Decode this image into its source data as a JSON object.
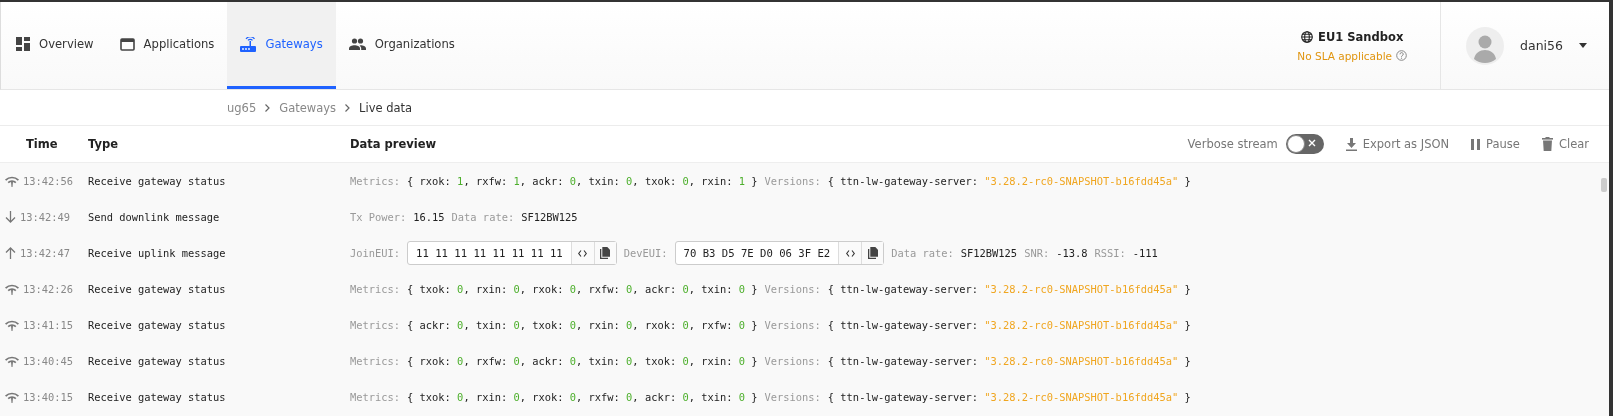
{
  "nav": {
    "tabs": [
      {
        "label": "Overview",
        "selected": false
      },
      {
        "label": "Applications",
        "selected": false
      },
      {
        "label": "Gateways",
        "selected": true
      },
      {
        "label": "Organizations",
        "selected": false
      }
    ]
  },
  "cluster": {
    "name": "**EU1** Sandbox",
    "note": "No SLA applicable"
  },
  "user": {
    "name": "dani56"
  },
  "breadcrumbs": [
    {
      "label": "ug65",
      "current": false
    },
    {
      "label": "Gateways",
      "current": false
    },
    {
      "label": "Live data",
      "current": true
    }
  ],
  "table": {
    "columns": [
      "Time",
      "Type",
      "Data preview"
    ],
    "toolbar": {
      "verbose": {
        "label": "Verbose stream",
        "on": false
      },
      "buttons": [
        {
          "label": "Export as JSON"
        },
        {
          "label": "Pause"
        },
        {
          "label": "Clear"
        }
      ]
    },
    "rows": [
      {
        "kind": "status",
        "time": "13:42:56",
        "type": "Receive gateway status",
        "preview": [
          {
            "kind": "object",
            "label": "Metrics:",
            "open": "{",
            "close": "}",
            "separator": ",",
            "entries": [
              {
                "key": "rxok:",
                "value": "1",
                "kind": "number"
              },
              {
                "key": "rxfw:",
                "value": "1",
                "kind": "number"
              },
              {
                "key": "ackr:",
                "value": "0",
                "kind": "number"
              },
              {
                "key": "txin:",
                "value": "0",
                "kind": "number"
              },
              {
                "key": "txok:",
                "value": "0",
                "kind": "number"
              },
              {
                "key": "rxin:",
                "value": "1",
                "kind": "number"
              }
            ]
          },
          {
            "kind": "object",
            "label": "Versions:",
            "open": "{",
            "close": "}",
            "entries": [
              {
                "key": "ttn-lw-gateway-server:",
                "value": "\"3.28.2-rc0-SNAPSHOT-b16fdd45a\"",
                "kind": "string"
              }
            ]
          }
        ]
      },
      {
        "kind": "downlink",
        "time": "13:42:49",
        "type": "Send downlink message",
        "preview": [
          {
            "kind": "pair",
            "label": "Tx Power:",
            "value": "16.15"
          },
          {
            "kind": "pair",
            "label": "Data rate:",
            "value": "SF12BW125"
          }
        ]
      },
      {
        "kind": "uplink",
        "time": "13:42:47",
        "type": "Receive uplink message",
        "preview": [
          {
            "kind": "eui",
            "label": "JoinEUI:",
            "value": "11 11 11 11 11 11 11 11"
          },
          {
            "kind": "eui",
            "label": "DevEUI:",
            "value": "70 B3 D5 7E D0 06 3F E2"
          },
          {
            "kind": "pair",
            "label": "Data rate:",
            "value": "SF12BW125"
          },
          {
            "kind": "pair",
            "label": "SNR:",
            "value": "-13.8"
          },
          {
            "kind": "pair",
            "label": "RSSI:",
            "value": "-111"
          }
        ]
      },
      {
        "kind": "status",
        "time": "13:42:26",
        "type": "Receive gateway status",
        "preview": [
          {
            "kind": "object",
            "label": "Metrics:",
            "open": "{",
            "close": "}",
            "separator": ",",
            "entries": [
              {
                "key": "txok:",
                "value": "0",
                "kind": "number"
              },
              {
                "key": "rxin:",
                "value": "0",
                "kind": "number"
              },
              {
                "key": "rxok:",
                "value": "0",
                "kind": "number"
              },
              {
                "key": "rxfw:",
                "value": "0",
                "kind": "number"
              },
              {
                "key": "ackr:",
                "value": "0",
                "kind": "number"
              },
              {
                "key": "txin:",
                "value": "0",
                "kind": "number"
              }
            ]
          },
          {
            "kind": "object",
            "label": "Versions:",
            "open": "{",
            "close": "}",
            "entries": [
              {
                "key": "ttn-lw-gateway-server:",
                "value": "\"3.28.2-rc0-SNAPSHOT-b16fdd45a\"",
                "kind": "string"
              }
            ]
          }
        ]
      },
      {
        "kind": "status",
        "time": "13:41:15",
        "type": "Receive gateway status",
        "preview": [
          {
            "kind": "object",
            "label": "Metrics:",
            "open": "{",
            "close": "}",
            "separator": ",",
            "entries": [
              {
                "key": "ackr:",
                "value": "0",
                "kind": "number"
              },
              {
                "key": "txin:",
                "value": "0",
                "kind": "number"
              },
              {
                "key": "txok:",
                "value": "0",
                "kind": "number"
              },
              {
                "key": "rxin:",
                "value": "0",
                "kind": "number"
              },
              {
                "key": "rxok:",
                "value": "0",
                "kind": "number"
              },
              {
                "key": "rxfw:",
                "value": "0",
                "kind": "number"
              }
            ]
          },
          {
            "kind": "object",
            "label": "Versions:",
            "open": "{",
            "close": "}",
            "entries": [
              {
                "key": "ttn-lw-gateway-server:",
                "value": "\"3.28.2-rc0-SNAPSHOT-b16fdd45a\"",
                "kind": "string"
              }
            ]
          }
        ]
      },
      {
        "kind": "status",
        "time": "13:40:45",
        "type": "Receive gateway status",
        "preview": [
          {
            "kind": "object",
            "label": "Metrics:",
            "open": "{",
            "close": "}",
            "separator": ",",
            "entries": [
              {
                "key": "rxok:",
                "value": "0",
                "kind": "number"
              },
              {
                "key": "rxfw:",
                "value": "0",
                "kind": "number"
              },
              {
                "key": "ackr:",
                "value": "0",
                "kind": "number"
              },
              {
                "key": "txin:",
                "value": "0",
                "kind": "number"
              },
              {
                "key": "txok:",
                "value": "0",
                "kind": "number"
              },
              {
                "key": "rxin:",
                "value": "0",
                "kind": "number"
              }
            ]
          },
          {
            "kind": "object",
            "label": "Versions:",
            "open": "{",
            "close": "}",
            "entries": [
              {
                "key": "ttn-lw-gateway-server:",
                "value": "\"3.28.2-rc0-SNAPSHOT-b16fdd45a\"",
                "kind": "string"
              }
            ]
          }
        ]
      },
      {
        "kind": "status",
        "time": "13:40:15",
        "type": "Receive gateway status",
        "preview": [
          {
            "kind": "object",
            "label": "Metrics:",
            "open": "{",
            "close": "}",
            "separator": ",",
            "entries": [
              {
                "key": "txok:",
                "value": "0",
                "kind": "number"
              },
              {
                "key": "rxin:",
                "value": "0",
                "kind": "number"
              },
              {
                "key": "rxok:",
                "value": "0",
                "kind": "number"
              },
              {
                "key": "rxfw:",
                "value": "0",
                "kind": "number"
              },
              {
                "key": "ackr:",
                "value": "0",
                "kind": "number"
              },
              {
                "key": "txin:",
                "value": "0",
                "kind": "number"
              }
            ]
          },
          {
            "kind": "object",
            "label": "Versions:",
            "open": "{",
            "close": "}",
            "entries": [
              {
                "key": "ttn-lw-gateway-server:",
                "value": "\"3.28.2-rc0-SNAPSHOT-b16fdd45a\"",
                "kind": "string"
              }
            ]
          }
        ]
      }
    ]
  }
}
